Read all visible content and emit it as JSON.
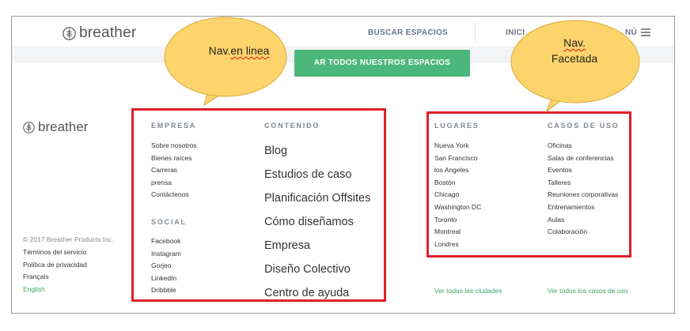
{
  "header": {
    "brand": "breather",
    "search_label": "BUSCAR ESPACIOS",
    "login_label": "INICI",
    "menu_label": "NÚ"
  },
  "cta": {
    "label": "AR TODOS NUESTROS ESPACIOS"
  },
  "footer": {
    "brand": "breather",
    "empresa": {
      "title": "EMPRESA",
      "links": [
        "Sobre nosotros",
        "Bienes raíces",
        "Carreras",
        "prensa",
        "Contáctenos"
      ]
    },
    "social": {
      "title": "SOCIAL",
      "links": [
        "Facebook",
        "Instagram",
        "Gorjeo",
        "LinkedIn",
        "Dribbble"
      ]
    },
    "contenido": {
      "title": "CONTENIDO",
      "links": [
        "Blog",
        "Estudios de caso",
        "Planificación Offsites",
        "Cómo diseñamos",
        "Empresa",
        "Diseño Colectivo",
        "Centro de ayuda"
      ]
    },
    "lugares": {
      "title": "LUGARES",
      "links": [
        "Nueva York",
        "San Francisco",
        "los Angeles",
        "Bostón",
        "Chicago",
        "Washington DC",
        "Toronto",
        "Montreal",
        "Londres"
      ],
      "see_all": "Ver todas las ciudades"
    },
    "casos": {
      "title": "CASOS DE USO",
      "links": [
        "Oficinas",
        "Salas de conferencias",
        "Eventos",
        "Talleres",
        "Reuniones corporativas",
        "Entrenamientos",
        "Aulas",
        "Colaboración"
      ],
      "see_all": "Ver todos los casos de uso"
    },
    "copyright": "© 2017 Breather Products Inc.",
    "legal": [
      "Términos del servicio",
      "Política de privacidad",
      "Français",
      "English"
    ]
  },
  "annotations": {
    "inline": {
      "word1": "Nav.",
      "word2": "en linea"
    },
    "faceted": {
      "line1": "Nav.",
      "line2": "Facetada"
    },
    "bubble_color": "#fdd46b",
    "box_color": "#e0202a"
  },
  "colors": {
    "accent_green": "#4cb77a",
    "link_green": "#3aa567"
  }
}
